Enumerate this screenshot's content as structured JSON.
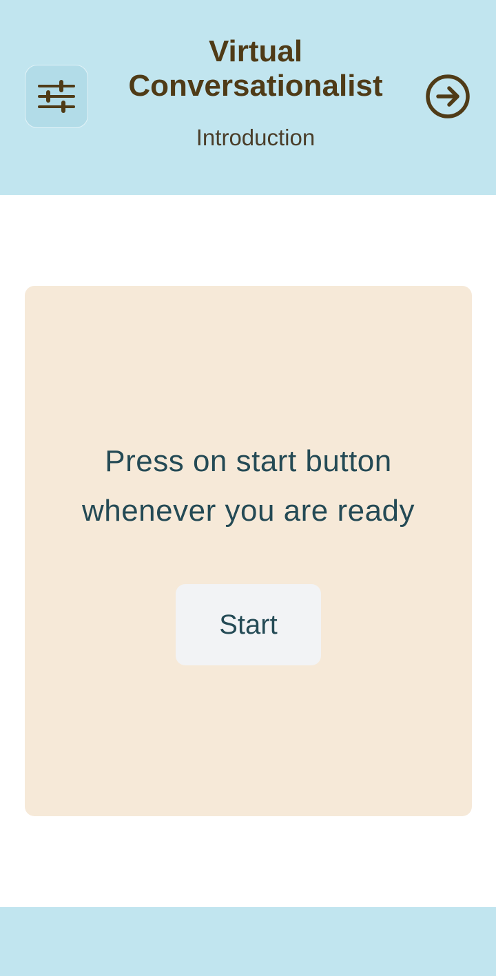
{
  "header": {
    "title_line1": "Virtual",
    "title_line2": "Conversationalist",
    "subtitle": "Introduction",
    "settings_icon": "sliders-icon",
    "next_icon": "arrow-right-circle-icon"
  },
  "main": {
    "prompt_line1": "Press on start button",
    "prompt_line2": "whenever you are ready",
    "start_label": "Start"
  },
  "colors": {
    "header_bg": "#c1e5ef",
    "card_bg": "#f6e9d8",
    "title_brown": "#4f3b17",
    "text_teal": "#244a55",
    "button_bg": "#f2f3f5"
  }
}
